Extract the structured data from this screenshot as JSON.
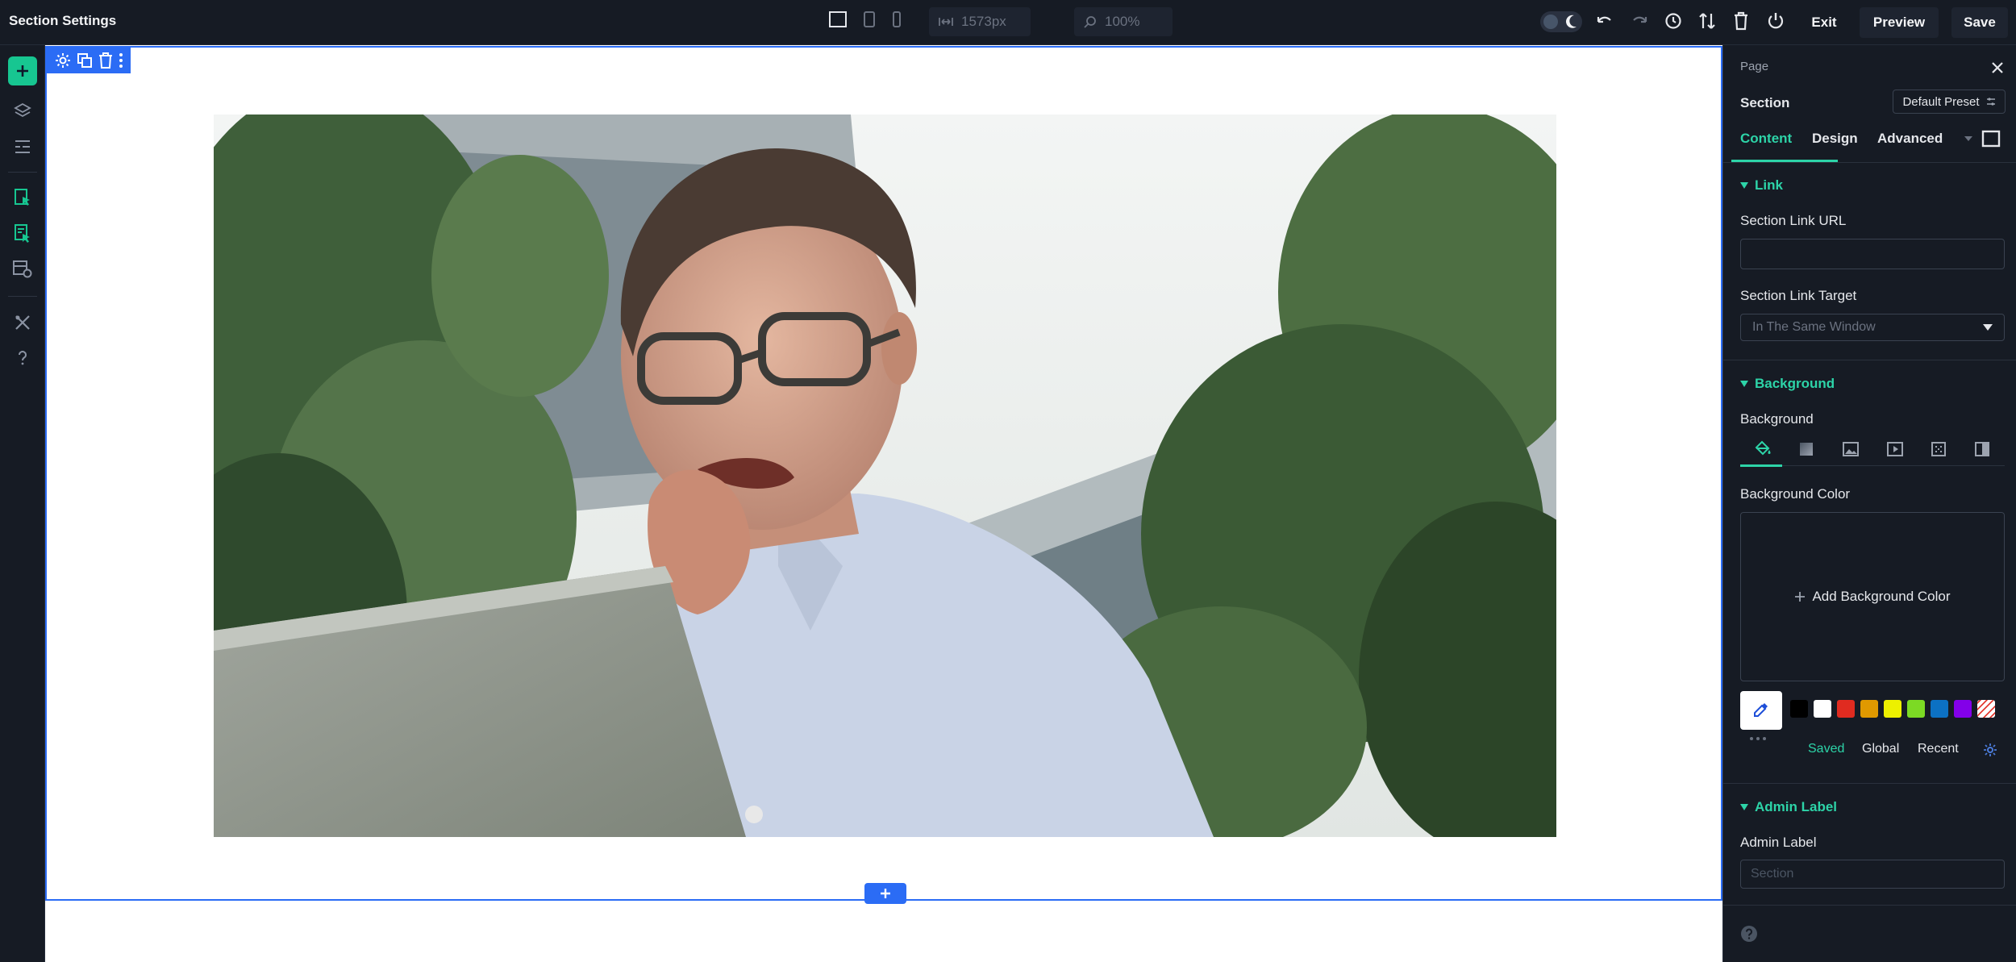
{
  "app": {
    "title": "Section Settings"
  },
  "topbar": {
    "width_value": "1573px",
    "zoom_value": "100%",
    "exit_label": "Exit",
    "preview_label": "Preview",
    "save_label": "Save"
  },
  "panel": {
    "breadcrumb": "Page",
    "element_title": "Section",
    "preset_label": "Default Preset",
    "tabs": [
      {
        "label": "Content",
        "active": true
      },
      {
        "label": "Design",
        "active": false
      },
      {
        "label": "Advanced",
        "active": false
      }
    ],
    "link_group": {
      "title": "Link",
      "url_label": "Section Link URL",
      "url_value": "",
      "target_label": "Section Link Target",
      "target_value": "In The Same Window"
    },
    "background_group": {
      "title": "Background",
      "background_label": "Background",
      "tabs": [
        "color-fill-icon",
        "gradient-icon",
        "image-icon",
        "video-icon",
        "pattern-icon",
        "mask-icon"
      ],
      "color_label": "Background Color",
      "add_color_label": "Add Background Color",
      "swatches": [
        "#000000",
        "#ffffff",
        "#e02b20",
        "#e09900",
        "#edf000",
        "#7cda24",
        "#0c71c3",
        "#8300e9",
        "none"
      ],
      "palette_tabs": [
        "Saved",
        "Global",
        "Recent"
      ]
    },
    "admin_group": {
      "title": "Admin Label",
      "label": "Admin Label",
      "placeholder": "Section"
    }
  },
  "colors": {
    "accent": "#2dd4a8",
    "selection": "#2b6cf5",
    "chrome": "#161b24"
  }
}
